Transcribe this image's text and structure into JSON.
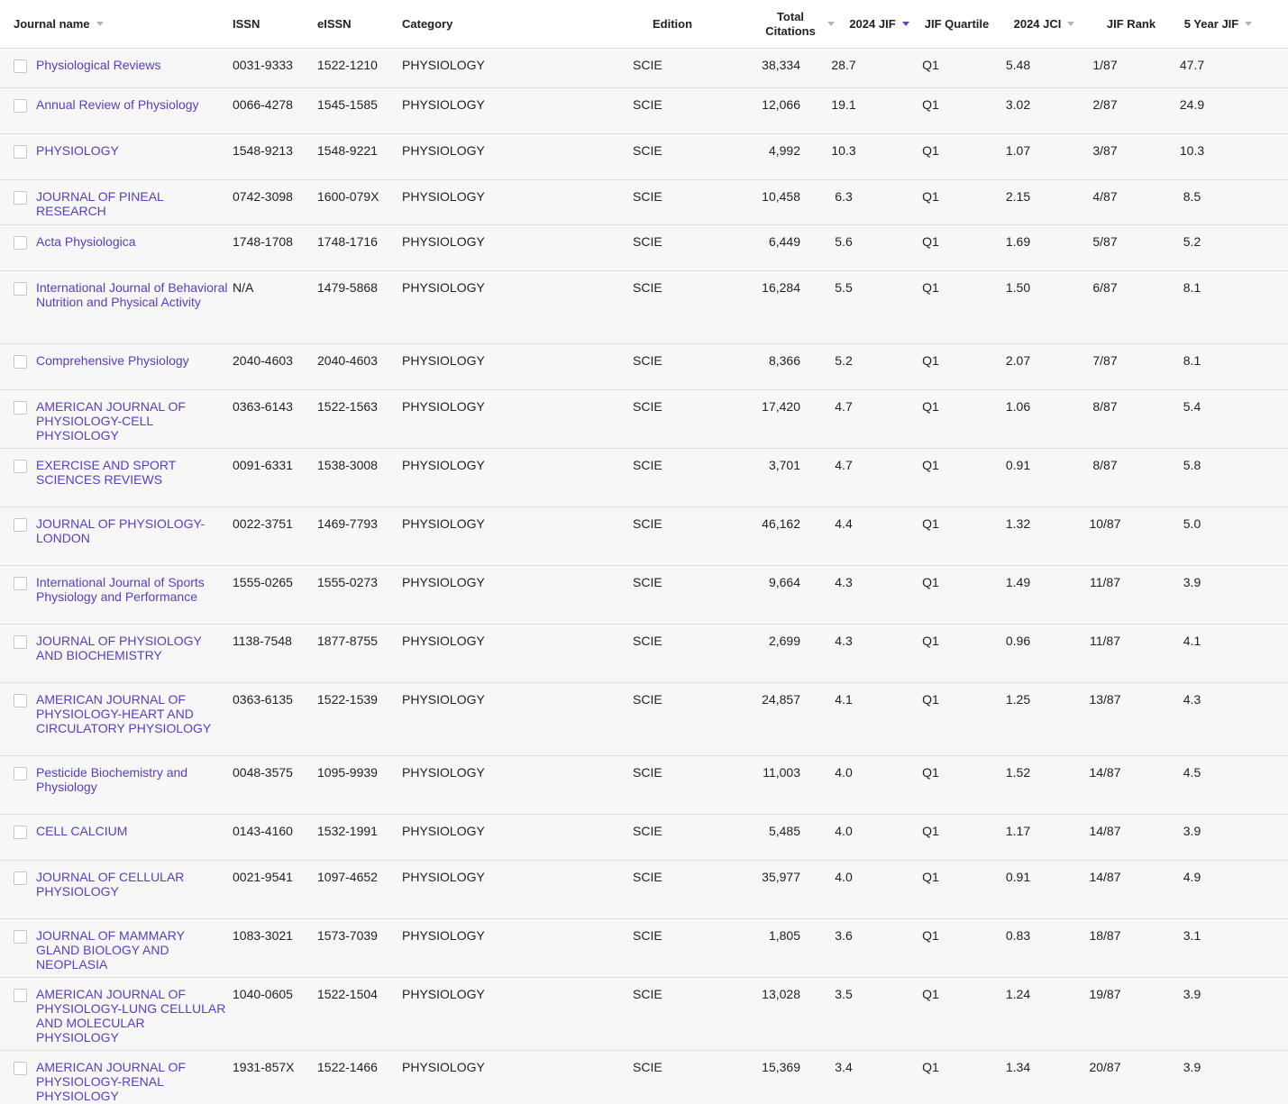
{
  "headers": {
    "journal_name": "Journal name",
    "issn": "ISSN",
    "eissn": "eISSN",
    "category": "Category",
    "edition": "Edition",
    "total_citations": "Total Citations",
    "jif": "2024 JIF",
    "quartile": "JIF Quartile",
    "jci": "2024 JCI",
    "rank": "JIF Rank",
    "five_year": "5 Year JIF"
  },
  "rows": [
    {
      "name": "Physiological Reviews",
      "issn": "0031-9333",
      "eissn": "1522-1210",
      "category": "PHYSIOLOGY",
      "edition": "SCIE",
      "citations": "38,334",
      "jif": "28.7",
      "quartile": "Q1",
      "jci": "5.48",
      "rank": "1/87",
      "five": "47.7",
      "lines": 1
    },
    {
      "name": "Annual Review of Physiology",
      "issn": "0066-4278",
      "eissn": "1545-1585",
      "category": "PHYSIOLOGY",
      "edition": "SCIE",
      "citations": "12,066",
      "jif": "19.1",
      "quartile": "Q1",
      "jci": "3.02",
      "rank": "2/87",
      "five": "24.9",
      "lines": 1
    },
    {
      "name": "PHYSIOLOGY",
      "issn": "1548-9213",
      "eissn": "1548-9221",
      "category": "PHYSIOLOGY",
      "edition": "SCIE",
      "citations": "4,992",
      "jif": "10.3",
      "quartile": "Q1",
      "jci": "1.07",
      "rank": "3/87",
      "five": "10.3",
      "lines": 1
    },
    {
      "name": "JOURNAL OF PINEAL RESEARCH",
      "issn": "0742-3098",
      "eissn": "1600-079X",
      "category": "PHYSIOLOGY",
      "edition": "SCIE",
      "citations": "10,458",
      "jif": "6.3",
      "quartile": "Q1",
      "jci": "2.15",
      "rank": "4/87",
      "five": "8.5",
      "lines": 1
    },
    {
      "name": "Acta Physiologica",
      "issn": "1748-1708",
      "eissn": "1748-1716",
      "category": "PHYSIOLOGY",
      "edition": "SCIE",
      "citations": "6,449",
      "jif": "5.6",
      "quartile": "Q1",
      "jci": "1.69",
      "rank": "5/87",
      "five": "5.2",
      "lines": 1
    },
    {
      "name": "International Journal of Behavioral Nutrition and Physical Activity",
      "issn": "N/A",
      "eissn": "1479-5868",
      "category": "PHYSIOLOGY",
      "edition": "SCIE",
      "citations": "16,284",
      "jif": "5.5",
      "quartile": "Q1",
      "jci": "1.50",
      "rank": "6/87",
      "five": "8.1",
      "lines": 3
    },
    {
      "name": "Comprehensive Physiology",
      "issn": "2040-4603",
      "eissn": "2040-4603",
      "category": "PHYSIOLOGY",
      "edition": "SCIE",
      "citations": "8,366",
      "jif": "5.2",
      "quartile": "Q1",
      "jci": "2.07",
      "rank": "7/87",
      "five": "8.1",
      "lines": 1
    },
    {
      "name": "AMERICAN JOURNAL OF PHYSIOLOGY-CELL PHYSIOLOGY",
      "issn": "0363-6143",
      "eissn": "1522-1563",
      "category": "PHYSIOLOGY",
      "edition": "SCIE",
      "citations": "17,420",
      "jif": "4.7",
      "quartile": "Q1",
      "jci": "1.06",
      "rank": "8/87",
      "five": "5.4",
      "lines": 2
    },
    {
      "name": "EXERCISE AND SPORT SCIENCES REVIEWS",
      "issn": "0091-6331",
      "eissn": "1538-3008",
      "category": "PHYSIOLOGY",
      "edition": "SCIE",
      "citations": "3,701",
      "jif": "4.7",
      "quartile": "Q1",
      "jci": "0.91",
      "rank": "8/87",
      "five": "5.8",
      "lines": 2
    },
    {
      "name": "JOURNAL OF PHYSIOLOGY-LONDON",
      "issn": "0022-3751",
      "eissn": "1469-7793",
      "category": "PHYSIOLOGY",
      "edition": "SCIE",
      "citations": "46,162",
      "jif": "4.4",
      "quartile": "Q1",
      "jci": "1.32",
      "rank": "10/87",
      "five": "5.0",
      "lines": 2
    },
    {
      "name": "International Journal of Sports Physiology and Performance",
      "issn": "1555-0265",
      "eissn": "1555-0273",
      "category": "PHYSIOLOGY",
      "edition": "SCIE",
      "citations": "9,664",
      "jif": "4.3",
      "quartile": "Q1",
      "jci": "1.49",
      "rank": "11/87",
      "five": "3.9",
      "lines": 2
    },
    {
      "name": "JOURNAL OF PHYSIOLOGY AND BIOCHEMISTRY",
      "issn": "1138-7548",
      "eissn": "1877-8755",
      "category": "PHYSIOLOGY",
      "edition": "SCIE",
      "citations": "2,699",
      "jif": "4.3",
      "quartile": "Q1",
      "jci": "0.96",
      "rank": "11/87",
      "five": "4.1",
      "lines": 2
    },
    {
      "name": "AMERICAN JOURNAL OF PHYSIOLOGY-HEART AND CIRCULATORY PHYSIOLOGY",
      "issn": "0363-6135",
      "eissn": "1522-1539",
      "category": "PHYSIOLOGY",
      "edition": "SCIE",
      "citations": "24,857",
      "jif": "4.1",
      "quartile": "Q1",
      "jci": "1.25",
      "rank": "13/87",
      "five": "4.3",
      "lines": 3
    },
    {
      "name": "Pesticide Biochemistry and Physiology",
      "issn": "0048-3575",
      "eissn": "1095-9939",
      "category": "PHYSIOLOGY",
      "edition": "SCIE",
      "citations": "11,003",
      "jif": "4.0",
      "quartile": "Q1",
      "jci": "1.52",
      "rank": "14/87",
      "five": "4.5",
      "lines": 2
    },
    {
      "name": "CELL CALCIUM",
      "issn": "0143-4160",
      "eissn": "1532-1991",
      "category": "PHYSIOLOGY",
      "edition": "SCIE",
      "citations": "5,485",
      "jif": "4.0",
      "quartile": "Q1",
      "jci": "1.17",
      "rank": "14/87",
      "five": "3.9",
      "lines": 1
    },
    {
      "name": "JOURNAL OF CELLULAR PHYSIOLOGY",
      "issn": "0021-9541",
      "eissn": "1097-4652",
      "category": "PHYSIOLOGY",
      "edition": "SCIE",
      "citations": "35,977",
      "jif": "4.0",
      "quartile": "Q1",
      "jci": "0.91",
      "rank": "14/87",
      "five": "4.9",
      "lines": 2
    },
    {
      "name": "JOURNAL OF MAMMARY GLAND BIOLOGY AND NEOPLASIA",
      "issn": "1083-3021",
      "eissn": "1573-7039",
      "category": "PHYSIOLOGY",
      "edition": "SCIE",
      "citations": "1,805",
      "jif": "3.6",
      "quartile": "Q1",
      "jci": "0.83",
      "rank": "18/87",
      "five": "3.1",
      "lines": 2
    },
    {
      "name": "AMERICAN JOURNAL OF PHYSIOLOGY-LUNG CELLULAR AND MOLECULAR PHYSIOLOGY",
      "issn": "1040-0605",
      "eissn": "1522-1504",
      "category": "PHYSIOLOGY",
      "edition": "SCIE",
      "citations": "13,028",
      "jif": "3.5",
      "quartile": "Q1",
      "jci": "1.24",
      "rank": "19/87",
      "five": "3.9",
      "lines": 3
    },
    {
      "name": "AMERICAN JOURNAL OF PHYSIOLOGY-RENAL PHYSIOLOGY",
      "issn": "1931-857X",
      "eissn": "1522-1466",
      "category": "PHYSIOLOGY",
      "edition": "SCIE",
      "citations": "15,369",
      "jif": "3.4",
      "quartile": "Q1",
      "jci": "1.34",
      "rank": "20/87",
      "five": "3.9",
      "lines": 2
    }
  ]
}
